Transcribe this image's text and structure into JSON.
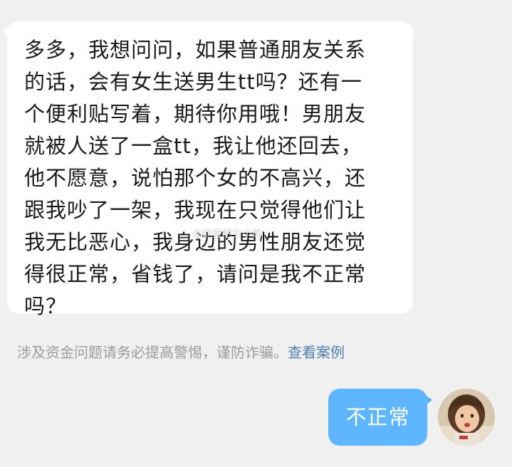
{
  "incoming_message": {
    "lines": [
      "多多，我想问问，如果普通朋友关系",
      "的话，会有女生送男生tt吗？还有一",
      "个便利贴写着，期待你用哦！男朋友",
      "就被人送了一盒tt，我让他还回去，",
      "他不愿意，说怕那个女的不高兴，还",
      "跟我吵了一架，我现在只觉得他们让",
      "我无比恶心，我身边的男性朋友还觉",
      "得很正常，省钱了，请问是我不正常",
      "吗？"
    ]
  },
  "watermark": {
    "text": "@蛇查吧女小助"
  },
  "warning": {
    "text": "涉及资金问题请务必提高警惕，谨防诈骗。",
    "link_label": "查看案例",
    "text_color": "#9a9a9a",
    "link_color": "#4f7fb0"
  },
  "outgoing_message": {
    "text": "不正常",
    "bubble_color": "#5db6ff"
  },
  "avatar": {
    "icon": "user-avatar-photo"
  }
}
